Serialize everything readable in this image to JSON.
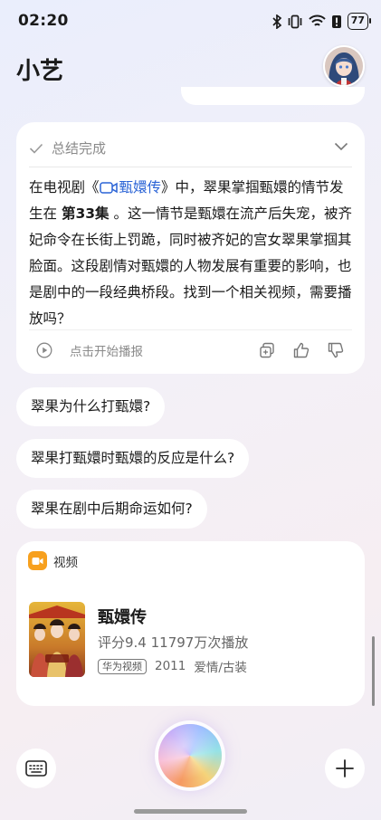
{
  "status_bar": {
    "time": "02:20",
    "battery": "77"
  },
  "header": {
    "title": "小艺"
  },
  "answer_card": {
    "summary_label": "总结完成",
    "answer_prefix": "在电视剧《",
    "link_text": "甄嬛传",
    "answer_mid": "》中，翠果掌掴甄嬛的情节发生在 ",
    "episode": "第33集",
    "answer_rest": " 。这一情节是甄嬛在流产后失宠，被齐妃命令在长街上罚跪，同时被齐妃的宫女翠果掌掴其脸面。这段剧情对甄嬛的人物发展有重要的影响，也是剧中的一段经典桥段。找到一个相关视频，需要播放吗？",
    "play_label": "点击开始播报"
  },
  "suggestions": [
    "翠果为什么打甄嬛?",
    "翠果打甄嬛时甄嬛的反应是什么?",
    "翠果在剧中后期命运如何?"
  ],
  "video_card": {
    "section_label": "视频",
    "title": "甄嬛传",
    "meta": "评分9.4  11797万次播放",
    "badge": "华为视频",
    "year": "2011",
    "genre": "爱情/古装"
  },
  "colors": {
    "link": "#2a63d6",
    "video_icon": "#f7a01e"
  }
}
